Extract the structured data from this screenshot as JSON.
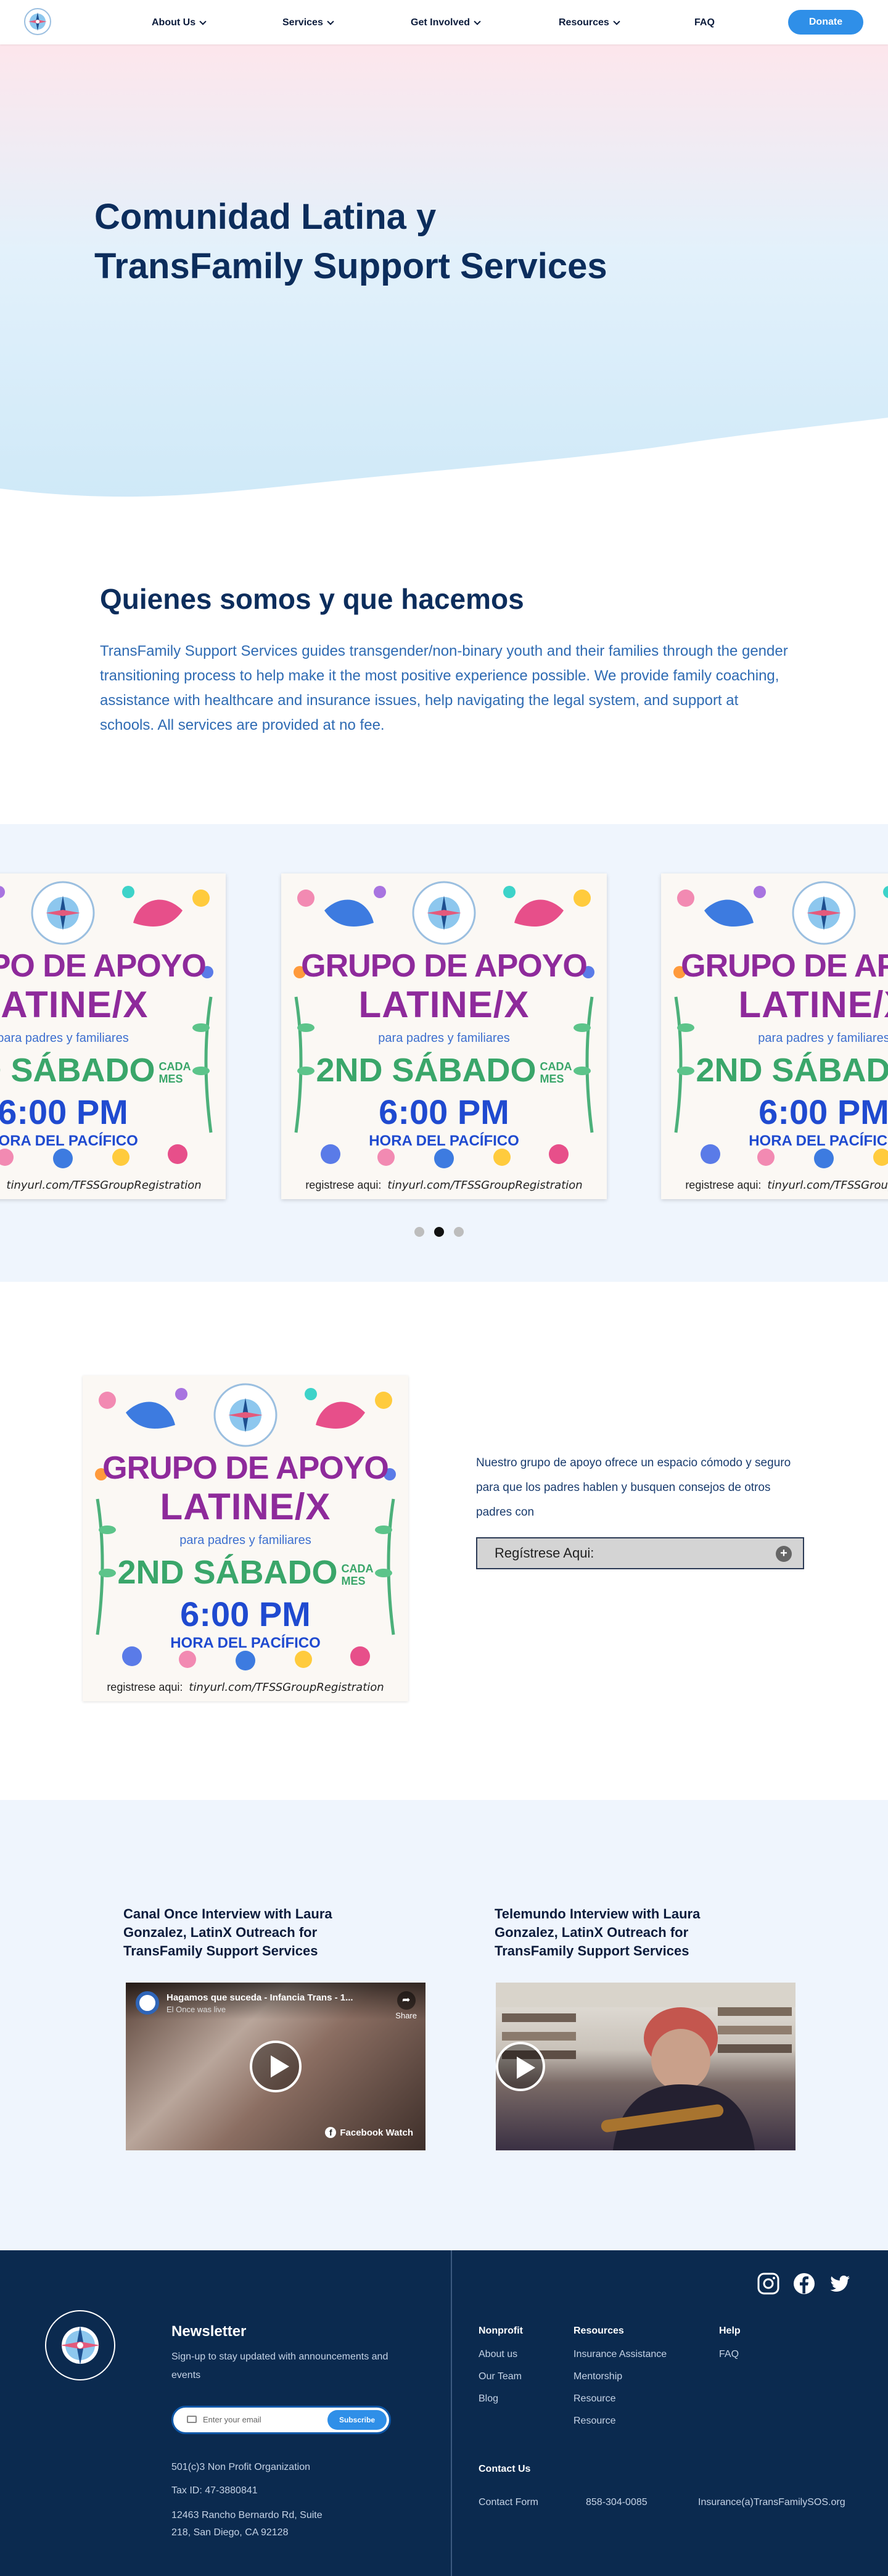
{
  "nav": {
    "items": [
      {
        "label": "About Us",
        "has_menu": true
      },
      {
        "label": "Services",
        "has_menu": true
      },
      {
        "label": "Get Involved",
        "has_menu": true
      },
      {
        "label": "Resources",
        "has_menu": true
      },
      {
        "label": "FAQ",
        "has_menu": false
      }
    ],
    "donate": "Donate"
  },
  "hero": {
    "title_line1": "Comunidad Latina y",
    "title_line2": "TransFamily Support Services"
  },
  "about": {
    "title": "Quienes somos y que hacemos",
    "text": "TransFamily Support Services guides transgender/non-binary youth and their families through the gender transitioning process to help make it the most positive experience possible. We provide family coaching, assistance with healthcare and insurance issues, help navigating the legal system, and support at schools. All services are provided at no fee."
  },
  "flyer": {
    "title1": "GRUPO DE APOYO",
    "title2": "LATINE/X",
    "subtitle": "para padres y familiares",
    "sabado": "2ND SÁBADO",
    "cada": "CADA",
    "mes": "MES",
    "time": "6:00 PM",
    "hora": "HORA DEL PACÍFICO",
    "reg_label": "registrese aqui:",
    "reg_url": "tinyurl.com/TFSSGroupRegistration"
  },
  "carousel": {
    "slides": 3,
    "active": 1
  },
  "signup": {
    "text": "Nuestro grupo de apoyo ofrece un espacio cómodo y seguro para que los padres hablen y busquen consejos de otros padres con",
    "register_label": "Regístrese Aqui:"
  },
  "videos": [
    {
      "title": "Canal Once Interview with Laura Gonzalez, LatinX Outreach for TransFamily Support Services",
      "embed_title": "Hagamos que suceda - Infancia Trans - 1...",
      "embed_sub": "El Once was live",
      "share": "Share",
      "watch": "Facebook Watch"
    },
    {
      "title": "Telemundo Interview with Laura Gonzalez, LatinX Outreach for TransFamily Support Services"
    }
  ],
  "footer": {
    "newsletter_title": "Newsletter",
    "newsletter_text": "Sign-up to stay updated with announcements and events",
    "email_placeholder": "Enter your email",
    "subscribe": "Subscribe",
    "org": "501(c)3 Non Profit Organization",
    "tax": "Tax ID: 47-3880841",
    "address_line1": "12463 Rancho Bernardo Rd, Suite",
    "address_line2": "218, San Diego, CA 92128",
    "col_nonprofit": "Nonprofit",
    "nonprofit_links": [
      "About us",
      "Our Team",
      "Blog"
    ],
    "col_resources": "Resources",
    "resources_links": [
      "Insurance Assistance",
      "Mentorship",
      "Resource",
      "Resource"
    ],
    "col_help": "Help",
    "help_links": [
      "FAQ"
    ],
    "contact_title": "Contact Us",
    "contact_form": "Contact Form",
    "phone": "858-304-0085",
    "email": "Insurance(a)TransFamilySOS.org",
    "social": [
      "instagram-icon",
      "facebook-icon",
      "twitter-icon"
    ]
  }
}
